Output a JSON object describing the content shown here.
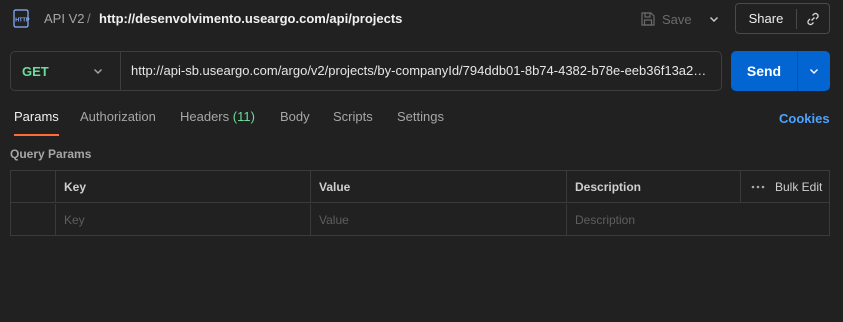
{
  "header": {
    "breadcrumb_parent": "API V2",
    "breadcrumb_separator": "/",
    "breadcrumb_current": "http://desenvolvimento.useargo.com/api/projects",
    "save_label": "Save",
    "share_label": "Share"
  },
  "request": {
    "method": "GET",
    "url": "http://api-sb.useargo.com/argo/v2/projects/by-companyId/794ddb01-8b74-4382-b78e-eeb36f13a2…",
    "send_label": "Send"
  },
  "tabs": [
    {
      "label": "Params",
      "active": true
    },
    {
      "label": "Authorization"
    },
    {
      "label": "Headers",
      "count": "(11)"
    },
    {
      "label": "Body"
    },
    {
      "label": "Scripts"
    },
    {
      "label": "Settings"
    }
  ],
  "cookies_label": "Cookies",
  "query_params": {
    "title": "Query Params",
    "columns": [
      "Key",
      "Value",
      "Description"
    ],
    "bulk_edit_label": "Bulk Edit",
    "placeholders": {
      "key": "Key",
      "value": "Value",
      "description": "Description"
    }
  },
  "colors": {
    "background": "#212121",
    "get_method": "#6bdd9a",
    "send_button": "#0265d2",
    "active_tab_underline": "#ff6c37",
    "cookies_link": "#4da3ff"
  },
  "icons": [
    "http-file-icon",
    "save-icon",
    "chevron-down-icon",
    "link-icon",
    "more-dots-icon"
  ]
}
